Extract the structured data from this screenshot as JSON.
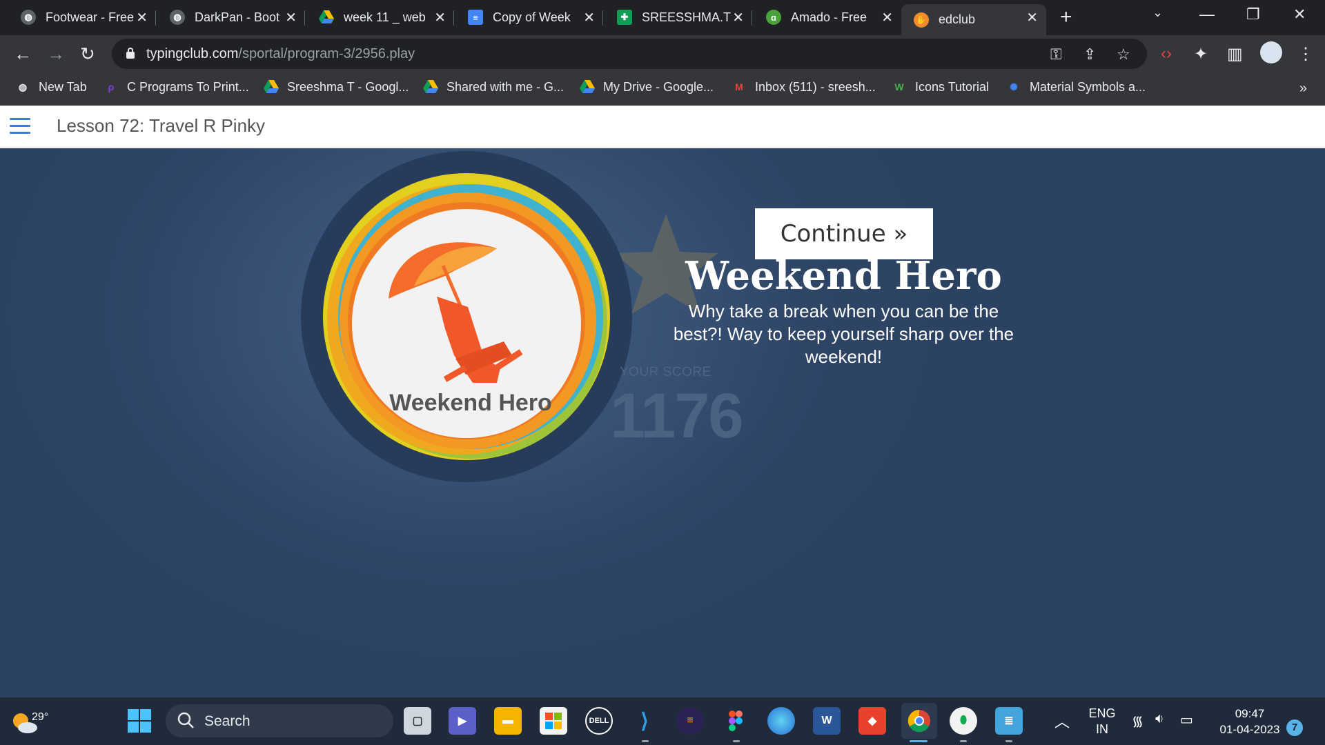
{
  "browser": {
    "tabs": [
      {
        "label": "Footwear - Free",
        "favicon": "globe-icon"
      },
      {
        "label": "DarkPan - Boot",
        "favicon": "globe-icon"
      },
      {
        "label": "week 11 _ web",
        "favicon": "google-drive-icon"
      },
      {
        "label": "Copy of Week",
        "favicon": "google-docs-icon"
      },
      {
        "label": "SREESSHMA.T",
        "favicon": "google-sheets-icon"
      },
      {
        "label": "Amado - Free",
        "favicon": "amado-icon"
      },
      {
        "label": "edclub",
        "favicon": "edclub-icon",
        "active": true
      }
    ],
    "url_host": "typingclub.com",
    "url_path": "/sportal/program-3/2956.play",
    "bookmarks": [
      {
        "label": "New Tab",
        "icon": "globe-icon"
      },
      {
        "label": "C Programs To Print...",
        "icon": "programiz-icon"
      },
      {
        "label": "Sreeshma T - Googl...",
        "icon": "google-drive-icon"
      },
      {
        "label": "Shared with me - G...",
        "icon": "google-drive-icon"
      },
      {
        "label": "My Drive - Google...",
        "icon": "google-drive-icon"
      },
      {
        "label": "Inbox (511) - sreesh...",
        "icon": "gmail-icon"
      },
      {
        "label": "Icons Tutorial",
        "icon": "w3schools-icon"
      },
      {
        "label": "Material Symbols a...",
        "icon": "material-icon"
      }
    ],
    "more_bookmarks": "»"
  },
  "page": {
    "lesson_title": "Lesson 72: Travel R Pinky",
    "badge_label": "Weekend Hero",
    "score_label": "YOUR SCORE",
    "score_value": "1176",
    "continue_label": "Continue »",
    "achievement_title": "Weekend Hero",
    "achievement_desc": "Why take a break when you can be the best?! Way to keep yourself sharp over the weekend!"
  },
  "taskbar": {
    "weather_temp": "29°",
    "search_placeholder": "Search",
    "language_line1": "ENG",
    "language_line2": "IN",
    "time": "09:47",
    "date": "01-04-2023",
    "notification_count": "7"
  },
  "colors": {
    "page_bg": "#2c4262",
    "badge_orange": "#f07a22",
    "badge_yellow": "#e6c81e",
    "accent_blue": "#3b7ddd"
  }
}
